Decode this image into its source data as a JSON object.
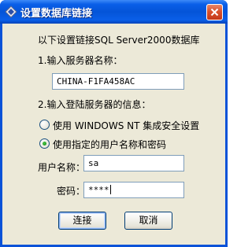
{
  "window": {
    "title": "设置数据库链接",
    "icon": "diamond-arrow-icon",
    "close_icon": "close-x-icon"
  },
  "form": {
    "intro": "以下设置链接SQL Server2000数据库",
    "step1_label": "1.输入服务器名称：",
    "server_name": "CHINA-F1FA458AC",
    "step2_label": "2.输入登陆服务器的信息：",
    "auth_options": [
      {
        "label": "使用 WINDOWS NT 集成安全设置",
        "selected": false
      },
      {
        "label": "使用指定的用户名称和密码",
        "selected": true
      }
    ],
    "username_label": "用户名称：",
    "username_value": "sa",
    "password_label": "密码：",
    "password_value": "****"
  },
  "buttons": {
    "connect_label": "连接",
    "cancel_label": "取消"
  },
  "colors": {
    "titlebar": "#0454d8",
    "client_bg": "#ece9d8",
    "close_button": "#d9512c",
    "radio_selected": "#21a121"
  }
}
